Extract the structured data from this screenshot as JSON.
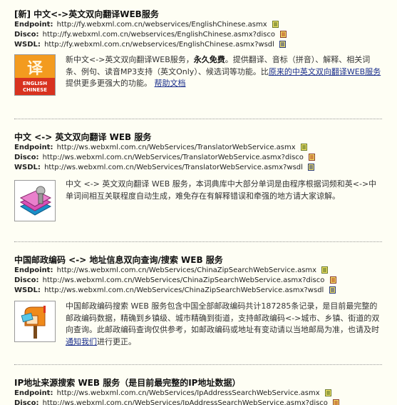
{
  "labels": {
    "endpoint": "Endpoint:",
    "disco": "Disco:",
    "wsdl": "WSDL:"
  },
  "services": [
    {
      "title": "[新] 中文<->英文双向翻译WEB服务",
      "endpoint": "http://fy.webxml.com.cn/webservices/EnglishChinese.asmx",
      "disco": "http://fy.webxml.com.cn/webservices/EnglishChinese.asmx?disco",
      "wsdl": "http://fy.webxml.com.cn/webservices/EnglishChinese.asmx?wsdl",
      "thumb_text": [
        "ENGLISH",
        "CHINESE"
      ],
      "desc_pre": "新中文<->英文双向翻译WEB服务，",
      "desc_bold": "永久免费",
      "desc_mid": "。提供翻译、音标（拼音）、解释、相关词条、例句、读音MP3支持（英文Only）、候选词等功能。比",
      "desc_link": "原来的中英文双向翻译WEB服务",
      "desc_post": "提供更多更强大的功能。",
      "help_link": "帮助文档"
    },
    {
      "title": "中文 <-> 英文双向翻译 WEB 服务",
      "endpoint": "http://ws.webxml.com.cn/WebServices/TranslatorWebService.asmx",
      "disco": "http://ws.webxml.com.cn/WebServices/TranslatorWebService.asmx?disco",
      "wsdl": "http://ws.webxml.com.cn/WebServices/TranslatorWebService.asmx?wsdl",
      "desc": "中文 <-> 英文双向翻译 WEB 服务，本词典库中大部分单词是由程序根据词频和英<->中单词间相互关联程度自动生成，难免存在有解释错误和牵强的地方请大家谅解。"
    },
    {
      "title": "中国邮政编码 <-> 地址信息双向查询/搜索 WEB 服务",
      "endpoint": "http://ws.webxml.com.cn/WebServices/ChinaZipSearchWebService.asmx",
      "disco": "http://ws.webxml.com.cn/WebServices/ChinaZipSearchWebService.asmx?disco",
      "wsdl": "http://ws.webxml.com.cn/WebServices/ChinaZipSearchWebService.asmx?wsdl",
      "desc_pre": "中国邮政编码搜索 WEB 服务包含中国全部邮政编码共计187285条记录，是目前最完整的邮政编码数据，精确到乡镇级、城市精确到街道，支持邮政编码<->城市、乡镇、街道的双向查询。此邮政编码查询仅供参考，如邮政编码或地址有变动请以当地邮局为准，也请及时",
      "desc_link": "通知我们",
      "desc_post": "进行更正。"
    },
    {
      "title": "IP地址来源搜索 WEB 服务（是目前最完整的IP地址数据）",
      "endpoint": "http://ws.webxml.com.cn/WebServices/IpAddressSearchWebService.asmx",
      "disco": "http://ws.webxml.com.cn/WebServices/IpAddressSearchWebService.asmx?disco"
    }
  ],
  "colors": {
    "background": "#fefef4",
    "link": "#1a2e8c",
    "thumb_red": "#d8321f",
    "thumb_orange": "#f39b1f"
  }
}
